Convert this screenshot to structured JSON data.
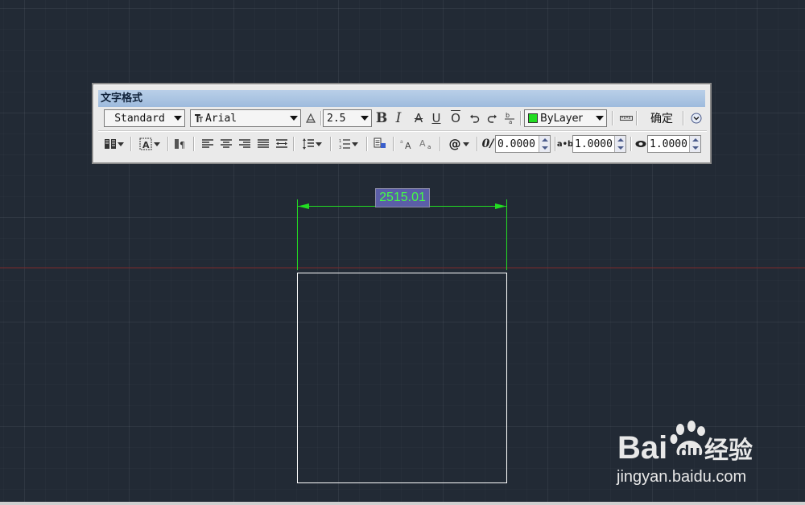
{
  "toolbar": {
    "title": "文字格式",
    "style_combo": "Standard",
    "font_combo": "Arial",
    "font_icon": "truetype-font-icon",
    "height_combo": "2.5",
    "bold": "B",
    "italic": "I",
    "strike": "A",
    "underline": "U",
    "overline": "O",
    "color_combo": "ByLayer",
    "color_swatch": "#22dd22",
    "ok_label": "确定",
    "oblique_value": "0.0000",
    "tracking_value": "1.0000",
    "width_value": "1.0000"
  },
  "drawing": {
    "dimension_value": "2515.01",
    "dim_color": "#22dd22",
    "rect_color": "#ffffff",
    "axis_color": "#8a2a2a"
  },
  "watermark": {
    "brand": "Bai",
    "brand2": "du",
    "cn": "经验",
    "url": "jingyan.baidu.com"
  }
}
